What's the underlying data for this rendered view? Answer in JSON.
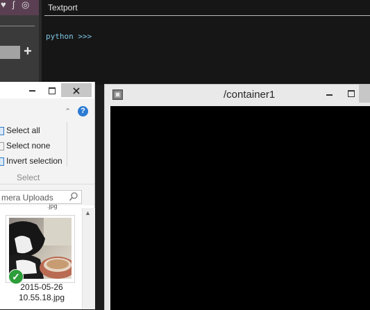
{
  "td": {
    "textport_tab": "Textport",
    "prompt": "python >>>",
    "top_icon_1": "♥",
    "top_icon_2": "ʃ",
    "top_icon_3": "◎",
    "add_button": "+"
  },
  "explorer": {
    "ribbon": {
      "select_all": "Select all",
      "select_none": "Select none",
      "invert_selection": "Invert selection",
      "group_label": "Select"
    },
    "search_text": "mera Uploads",
    "partial_top_text": "",
    "file": {
      "name": "2015-05-26 10.55.18.jpg"
    }
  },
  "container_window": {
    "title": "/container1"
  },
  "colors": {
    "accent_blue": "#2b7bd3",
    "check_green": "#2e9e3a",
    "prompt_cyan": "#7fc6e6"
  }
}
